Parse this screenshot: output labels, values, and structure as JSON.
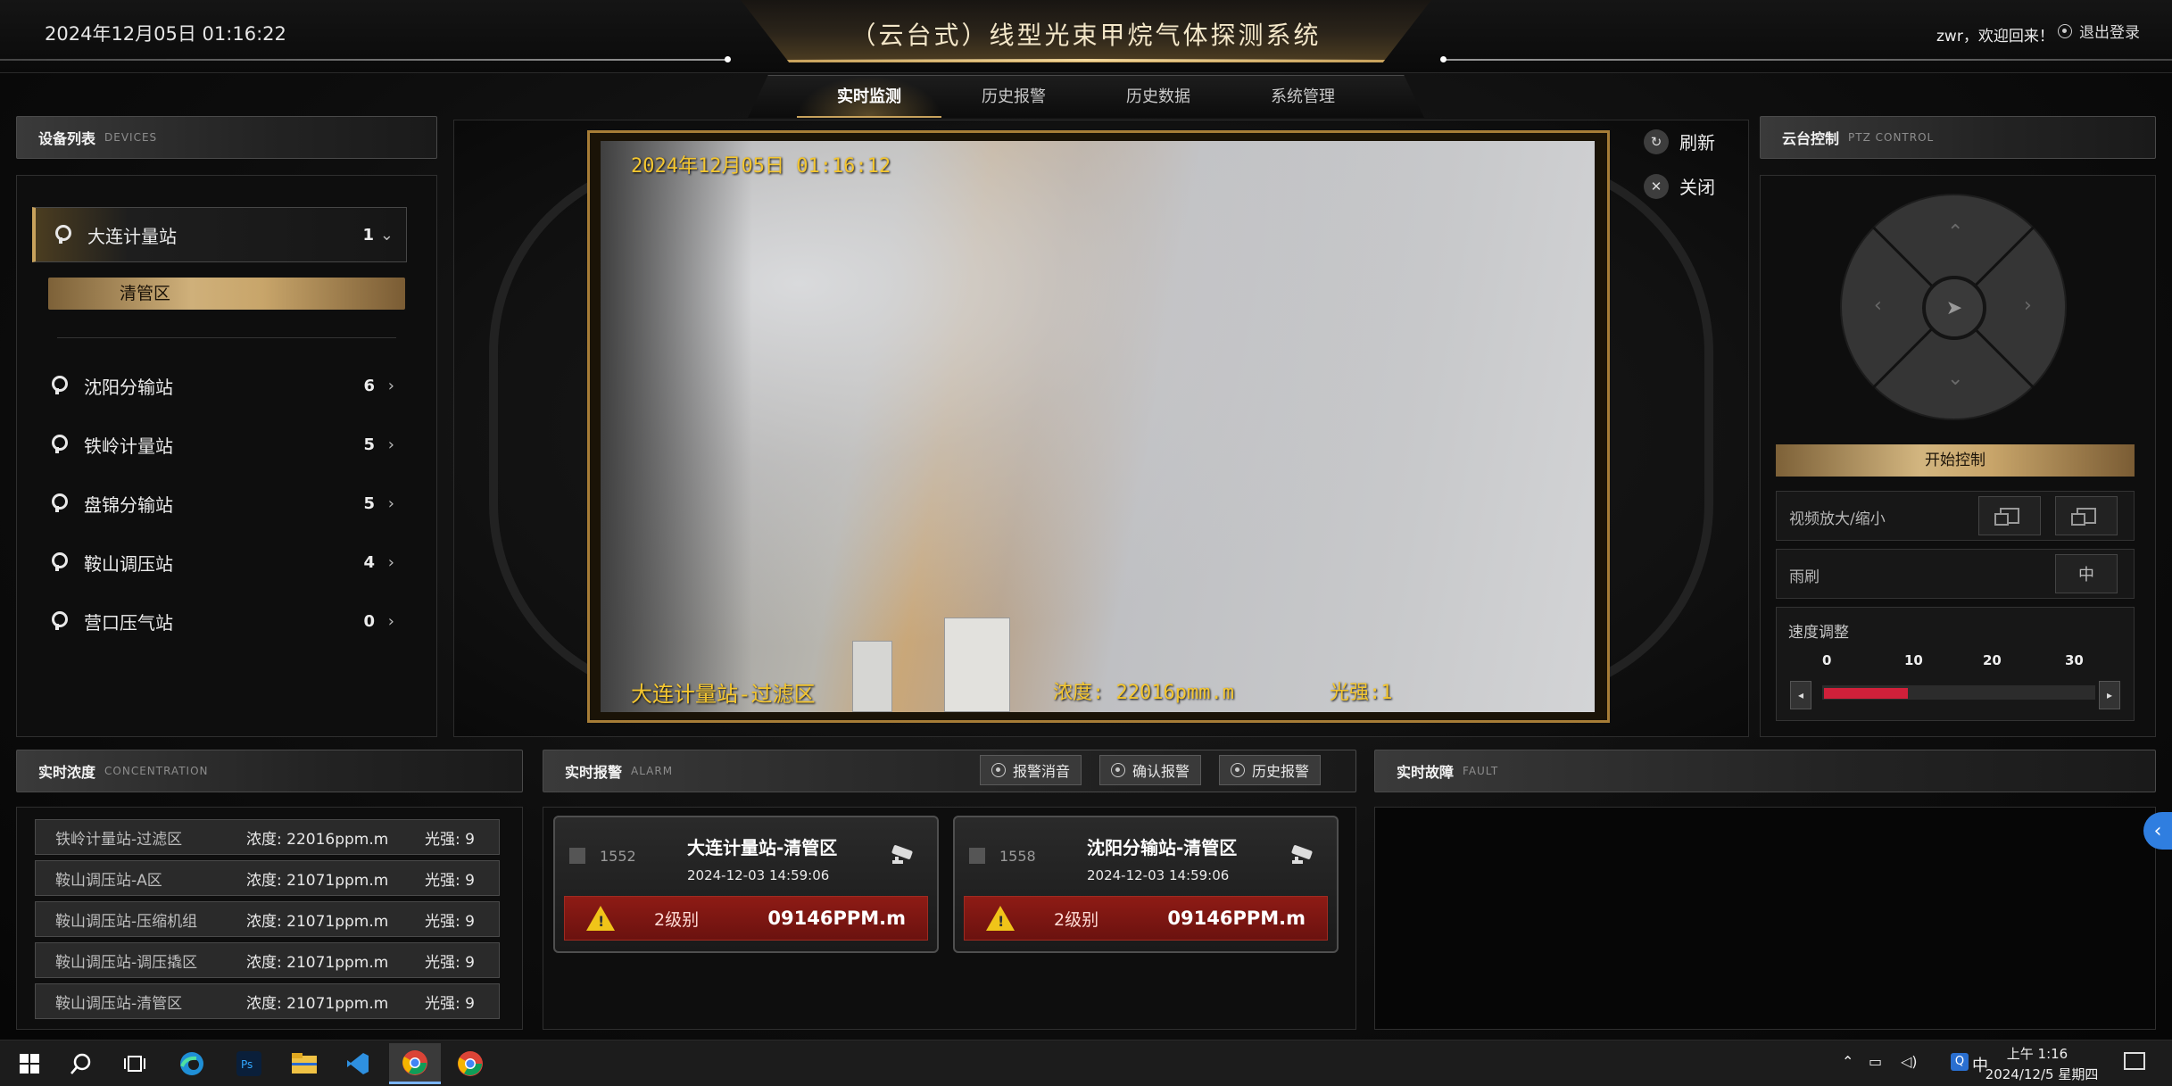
{
  "header": {
    "datetime": "2024年12月05日 01:16:22",
    "title": "（云台式）线型光束甲烷气体探测系统",
    "welcome": "zwr，欢迎回来！",
    "logout_label": "退出登录"
  },
  "nav": {
    "tabs": [
      {
        "label": "实时监测",
        "active": true
      },
      {
        "label": "历史报警"
      },
      {
        "label": "历史数据"
      },
      {
        "label": "系统管理"
      }
    ]
  },
  "devices": {
    "title": "设备列表",
    "subtitle": "DEVICES",
    "items": [
      {
        "name": "大连计量站",
        "count": "1",
        "expanded": true
      },
      {
        "name": "沈阳分输站",
        "count": "6"
      },
      {
        "name": "铁岭计量站",
        "count": "5"
      },
      {
        "name": "盘锦分输站",
        "count": "5"
      },
      {
        "name": "鞍山调压站",
        "count": "4"
      },
      {
        "name": "营口压气站",
        "count": "0"
      }
    ],
    "selected_area": "清管区"
  },
  "video": {
    "osd_time": "2024年12月05日  01:16:12",
    "osd_location": "大连计量站-过滤区",
    "osd_concentration": "浓度:  22016pmm.m",
    "osd_light": "光强:1",
    "refresh_label": "刷新",
    "close_label": "关闭"
  },
  "ptz": {
    "title": "云台控制",
    "subtitle": "PTZ CONTROL",
    "start_label": "开始控制",
    "zoom_label": "视频放大/缩小",
    "wiper_label": "雨刷",
    "wiper_button": "中",
    "speed_label": "速度调整",
    "speed_ticks": [
      "0",
      "10",
      "20",
      "30"
    ],
    "speed_value_fraction": 0.31
  },
  "concentration": {
    "title": "实时浓度",
    "subtitle": "CONCENTRATION",
    "rows": [
      {
        "name": "铁岭计量站-过滤区",
        "conc": "浓度: 22016ppm.m",
        "light": "光强: 9"
      },
      {
        "name": "鞍山调压站-A区",
        "conc": "浓度: 21071ppm.m",
        "light": "光强: 9"
      },
      {
        "name": "鞍山调压站-压缩机组",
        "conc": "浓度: 21071ppm.m",
        "light": "光强: 9"
      },
      {
        "name": "鞍山调压站-调压撬区",
        "conc": "浓度: 21071ppm.m",
        "light": "光强: 9"
      },
      {
        "name": "鞍山调压站-清管区",
        "conc": "浓度: 21071ppm.m",
        "light": "光强: 9"
      }
    ]
  },
  "alarm": {
    "title": "实时报警",
    "subtitle": "ALARM",
    "tools": [
      "报警消音",
      "确认报警",
      "历史报警"
    ],
    "cards": [
      {
        "id": "1552",
        "name": "大连计量站-清管区",
        "time": "2024-12-03 14:59:06",
        "level": "2级别",
        "ppm": "09146PPM.m"
      },
      {
        "id": "1558",
        "name": "沈阳分输站-清管区",
        "time": "2024-12-03 14:59:06",
        "level": "2级别",
        "ppm": "09146PPM.m"
      }
    ]
  },
  "fault": {
    "title": "实时故障",
    "subtitle": "FAULT"
  },
  "taskbar": {
    "ime": "中",
    "time": "上午 1:16",
    "date": "2024/12/5 星期四"
  },
  "colors": {
    "gold": "#c8a25c",
    "alarm_red": "#8e1b15",
    "osd_yellow": "#f4c630",
    "speed_red": "#d0203a"
  }
}
